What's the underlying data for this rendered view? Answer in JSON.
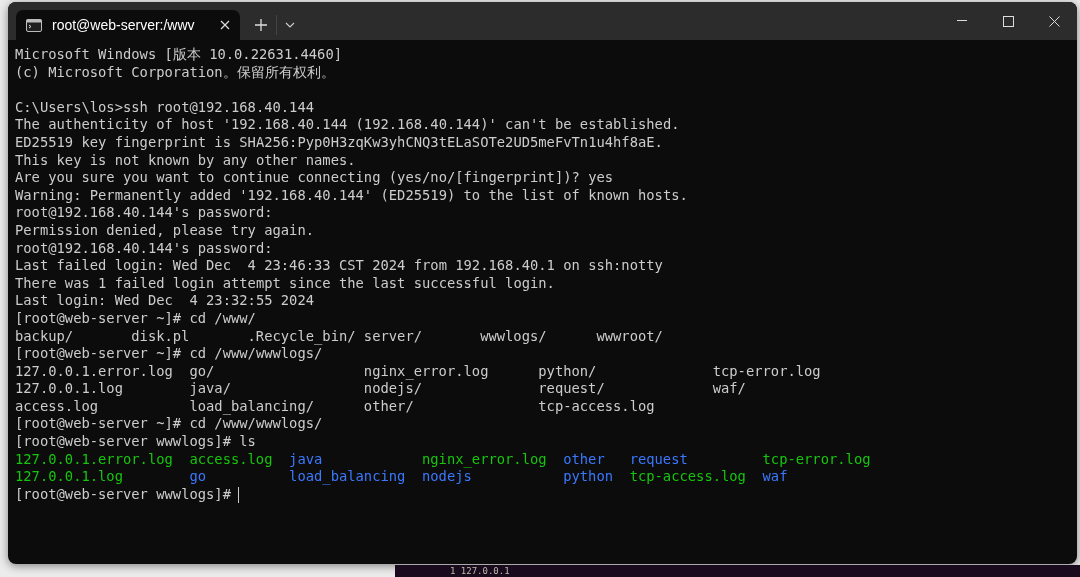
{
  "window": {
    "tab": {
      "title": "root@web-server:/wwv",
      "selected": true
    }
  },
  "terminal": {
    "lines": [
      {
        "kind": "text",
        "text": "Microsoft Windows [版本 10.0.22631.4460]"
      },
      {
        "kind": "text",
        "text": "(c) Microsoft Corporation。保留所有权利。"
      },
      {
        "kind": "blank"
      },
      {
        "kind": "text",
        "text": "C:\\Users\\los>ssh root@192.168.40.144"
      },
      {
        "kind": "text",
        "text": "The authenticity of host '192.168.40.144 (192.168.40.144)' can't be established."
      },
      {
        "kind": "text",
        "text": "ED25519 key fingerprint is SHA256:Pyp0H3zqKw3yhCNQ3tELaSOTe2UD5meFvTn1u4hf8aE."
      },
      {
        "kind": "text",
        "text": "This key is not known by any other names."
      },
      {
        "kind": "text",
        "text": "Are you sure you want to continue connecting (yes/no/[fingerprint])? yes"
      },
      {
        "kind": "text",
        "text": "Warning: Permanently added '192.168.40.144' (ED25519) to the list of known hosts."
      },
      {
        "kind": "text",
        "text": "root@192.168.40.144's password:"
      },
      {
        "kind": "text",
        "text": "Permission denied, please try again."
      },
      {
        "kind": "text",
        "text": "root@192.168.40.144's password:"
      },
      {
        "kind": "text",
        "text": "Last failed login: Wed Dec  4 23:46:33 CST 2024 from 192.168.40.1 on ssh:notty"
      },
      {
        "kind": "text",
        "text": "There was 1 failed login attempt since the last successful login."
      },
      {
        "kind": "text",
        "text": "Last login: Wed Dec  4 23:32:55 2024"
      },
      {
        "kind": "text",
        "text": "[root@web-server ~]# cd /www/"
      },
      {
        "kind": "listing",
        "rows": [
          [
            {
              "text": "backup/",
              "kind": "plain"
            },
            {
              "text": "disk.pl",
              "kind": "plain"
            },
            {
              "text": ".Recycle_bin/",
              "kind": "plain"
            },
            {
              "text": "server/",
              "kind": "plain"
            },
            {
              "text": "wwwlogs/",
              "kind": "plain"
            },
            {
              "text": "wwwroot/",
              "kind": "plain"
            }
          ]
        ]
      },
      {
        "kind": "text",
        "text": "[root@web-server ~]# cd /www/wwwlogs/"
      },
      {
        "kind": "listing",
        "rows": [
          [
            {
              "text": "127.0.0.1.error.log",
              "kind": "plain"
            },
            {
              "text": "go/",
              "kind": "plain"
            },
            {
              "text": "nginx_error.log",
              "kind": "plain"
            },
            {
              "text": "python/",
              "kind": "plain"
            },
            {
              "text": "tcp-error.log",
              "kind": "plain"
            }
          ],
          [
            {
              "text": "127.0.0.1.log",
              "kind": "plain"
            },
            {
              "text": "java/",
              "kind": "plain"
            },
            {
              "text": "nodejs/",
              "kind": "plain"
            },
            {
              "text": "request/",
              "kind": "plain"
            },
            {
              "text": "waf/",
              "kind": "plain"
            }
          ],
          [
            {
              "text": "access.log",
              "kind": "plain"
            },
            {
              "text": "load_balancing/",
              "kind": "plain"
            },
            {
              "text": "other/",
              "kind": "plain"
            },
            {
              "text": "tcp-access.log",
              "kind": "plain"
            }
          ]
        ]
      },
      {
        "kind": "text",
        "text": "[root@web-server ~]# cd /www/wwwlogs/"
      },
      {
        "kind": "text",
        "text": "[root@web-server wwwlogs]# ls"
      },
      {
        "kind": "color_listing",
        "rows": [
          [
            {
              "text": "127.0.0.1.error.log",
              "kind": "file"
            },
            {
              "text": "access.log",
              "kind": "file"
            },
            {
              "text": "java",
              "kind": "dir"
            },
            {
              "text": "nginx_error.log",
              "kind": "file"
            },
            {
              "text": "other",
              "kind": "dir"
            },
            {
              "text": "request",
              "kind": "dir"
            },
            {
              "text": "tcp-error.log",
              "kind": "file"
            }
          ],
          [
            {
              "text": "127.0.0.1.log",
              "kind": "file"
            },
            {
              "text": "go",
              "kind": "dir"
            },
            {
              "text": "load_balancing",
              "kind": "dir"
            },
            {
              "text": "nodejs",
              "kind": "dir"
            },
            {
              "text": "python",
              "kind": "dir"
            },
            {
              "text": "tcp-access.log",
              "kind": "file"
            },
            {
              "text": "waf",
              "kind": "dir"
            }
          ]
        ]
      },
      {
        "kind": "prompt",
        "text": "[root@web-server wwwlogs]#",
        "cursor": true
      }
    ]
  },
  "background_window": {
    "text": "1 127.0.0.1"
  }
}
